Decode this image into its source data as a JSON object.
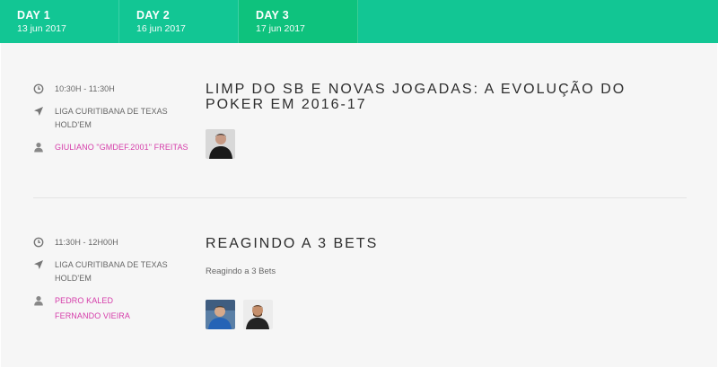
{
  "tabs": [
    {
      "day": "DAY 1",
      "date": "13 jun 2017"
    },
    {
      "day": "DAY 2",
      "date": "16 jun 2017"
    },
    {
      "day": "DAY 3",
      "date": "17 jun 2017"
    }
  ],
  "active_tab": 2,
  "sessions": [
    {
      "time": "10:30H - 11:30H",
      "location": "LIGA CURITIBANA DE TEXAS HOLD'EM",
      "speakers": [
        "GIULIANO \"GMDEF.2001\" FREITAS"
      ],
      "title": "LIMP DO SB E NOVAS JOGADAS: A EVOLUÇÃO DO POKER EM 2016-17",
      "description": ""
    },
    {
      "time": "11:30H - 12H00H",
      "location": "LIGA CURITIBANA DE TEXAS HOLD'EM",
      "speakers": [
        "PEDRO KALED",
        "FERNANDO VIEIRA"
      ],
      "title": "REAGINDO A 3 BETS",
      "description": "Reagindo a 3 Bets"
    }
  ],
  "colors": {
    "tab_bar": "#12c694",
    "tab_active": "#0ec27d",
    "speaker_link": "#d53ca9",
    "content_bg": "#f6f6f6"
  },
  "icons": {
    "time": "clock-icon",
    "location": "location-arrow-icon",
    "speaker": "user-icon"
  }
}
